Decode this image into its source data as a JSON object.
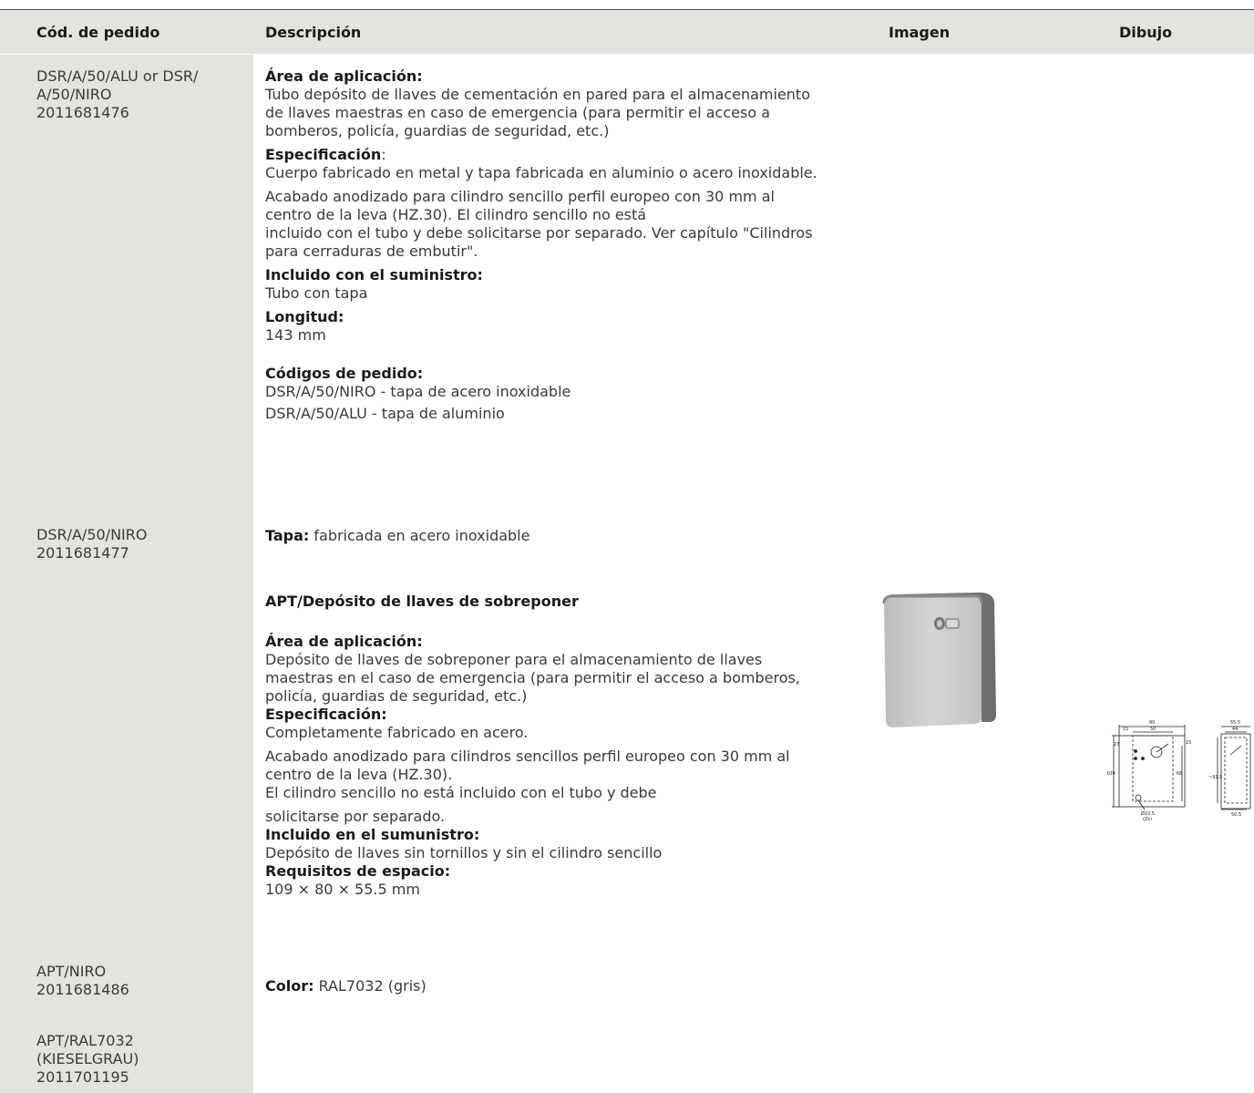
{
  "header": {
    "code": "Cód. de pedido",
    "description": "Descripción",
    "image": "Imagen",
    "drawing": "Dibujo"
  },
  "codes": {
    "c1": "DSR/A/50/ALU or DSR/\nA/50/NIRO\n2011681476",
    "c2": "DSR/A/50/NIRO\n2011681477",
    "c3": "APT/NIRO\n2011681486",
    "c4": "APT/RAL7032\n(KIESELGRAU)\n2011701195"
  },
  "block1": {
    "area_title": "Área de aplicación:",
    "area_text": "Tubo depósito de llaves de cementación en pared para el almacenamiento de llaves maestras en caso de emergencia (para permitir el acceso a bomberos, policía, guardias de seguridad, etc.)",
    "spec_title": "Especificación",
    "spec_colon": ":",
    "spec_text": "Cuerpo fabricado en metal y tapa fabricada en aluminio o acero inoxidable.",
    "finish_text1": "Acabado anodizado para cilindro sencillo perfil europeo con 30 mm al centro de la leva (HZ.30).  El cilindro sencillo no está",
    "finish_text2": "incluido con el tubo y debe solicitarse por separado. Ver capítulo \"Cilindros para cerraduras de embutir\".",
    "incl_title": "Incluido con el suministro:",
    "incl_text": "Tubo con tapa",
    "len_title": "Longitud:",
    "len_text": "143 mm",
    "codes_title": "Códigos de pedido:",
    "code_a": "DSR/A/50/NIRO - tapa de acero inoxidable",
    "code_b": "DSR/A/50/ALU - tapa de aluminio"
  },
  "block2": {
    "tapa_title": "Tapa:",
    "tapa_text": " fabricada en acero inoxidable"
  },
  "block3": {
    "title": "APT/Depósito de llaves de sobreponer",
    "area_title": "Área de aplicación:",
    "area_text": "Depósito de llaves de sobreponer para el almacenamiento de llaves maestras en el caso de emergencia (para permitir el acceso a bomberos, policía, guardias de seguridad, etc.)",
    "spec_title": "Especificación:",
    "spec_text": "Completamente fabricado en acero.",
    "finish_text1": "Acabado anodizado para cilindros sencillos perfil europeo con 30 mm al centro de la leva (HZ.30).",
    "finish_text2": "El cilindro sencillo no está incluido con el tubo y debe",
    "finish_text3": "solicitarse por separado.",
    "incl_title": "Incluido en el sumunistro:",
    "incl_text": "Depósito de llaves sin tornillos y sin el cilindro sencillo",
    "space_title": "Requisitos de espacio:",
    "space_text": "109 × 80 × 55.5 mm"
  },
  "block4": {
    "color_title": "Color:",
    "color_text": " RAL7032 (gris)"
  },
  "drawing_labels": {
    "w80": "80",
    "w50": "50",
    "w15": "15",
    "h27": "27",
    "h15": "15",
    "h109": "109",
    "h68": "68",
    "d10": "Ø10.5",
    "d2x": "(2x)",
    "s555": "55.5",
    "s44": "44",
    "s915": "~91.5",
    "s505": "50.5"
  }
}
